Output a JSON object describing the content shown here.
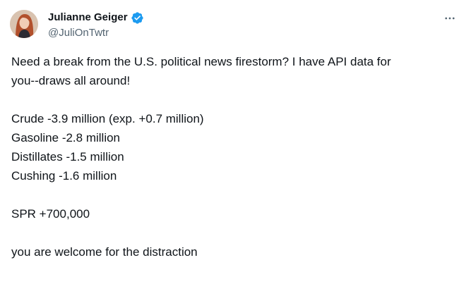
{
  "author": {
    "display_name": "Julianne Geiger",
    "handle": "@JuliOnTwtr",
    "verified_color": "#1d9bf0"
  },
  "icons": {
    "avatar": "avatar-photo",
    "verified": "verified-badge-icon",
    "more": "more-options-icon"
  },
  "tweet": {
    "intro_line_1": "Need a break from the U.S. political news firestorm? I have API data for",
    "intro_line_2": "you--draws all around!",
    "crude": "Crude -3.9 million (exp. +0.7 million)",
    "gasoline": "Gasoline -2.8 million",
    "distillates": "Distillates -1.5 million",
    "cushing": "Cushing -1.6 million",
    "spr": "SPR +700,000",
    "closing": "you are welcome for the distraction"
  }
}
